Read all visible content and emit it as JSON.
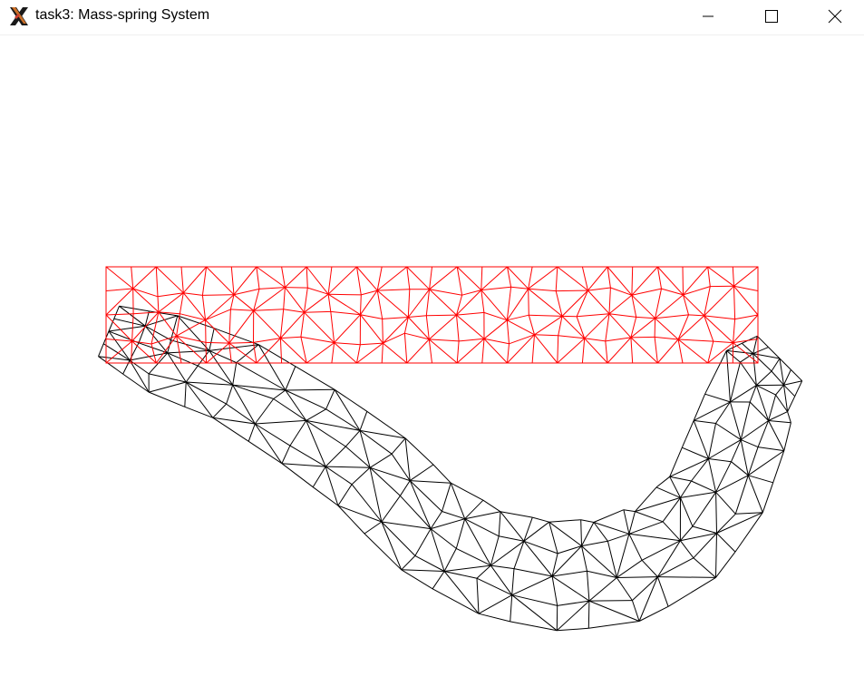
{
  "window": {
    "title": "task3: Mass-spring System",
    "app_icon": "x-logo-icon",
    "controls": {
      "minimize_icon": "minimize-icon",
      "maximize_icon": "maximize-icon",
      "close_icon": "close-icon"
    }
  },
  "scene": {
    "rest_mesh_color": "#ff0000",
    "deformed_mesh_color": "#000000",
    "background": "#ffffff"
  }
}
